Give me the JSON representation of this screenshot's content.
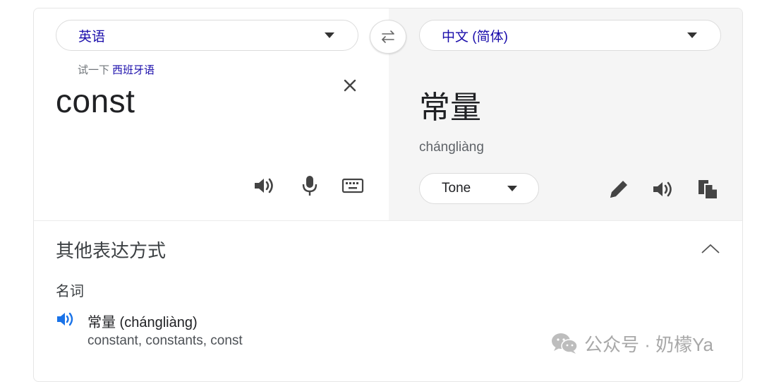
{
  "source": {
    "language": "英语",
    "try_prefix": "试一下",
    "try_language": "西班牙语",
    "text": "const"
  },
  "target": {
    "language": "中文 (简体)",
    "text": "常量",
    "romanization": "chángliàng",
    "tone": "Tone"
  },
  "alternatives": {
    "heading": "其他表达方式",
    "part_of_speech": "名词",
    "entries": [
      {
        "word": "常量 (chángliàng)",
        "translations": "constant, constants, const"
      }
    ]
  },
  "watermark": {
    "text": "公众号 · 奶檬Ya"
  },
  "icons": {
    "swap": "swap-arrows-icon",
    "clear": "close-icon",
    "speaker": "speaker-icon",
    "mic": "microphone-icon",
    "keyboard": "keyboard-icon",
    "edit": "pencil-icon",
    "copy": "copy-icon",
    "collapse": "chevron-up-icon",
    "wechat": "wechat-logo-icon"
  },
  "colors": {
    "link": "#1a0dab",
    "accent_speaker": "#1a73e8",
    "icon_gray": "#5f6368"
  }
}
